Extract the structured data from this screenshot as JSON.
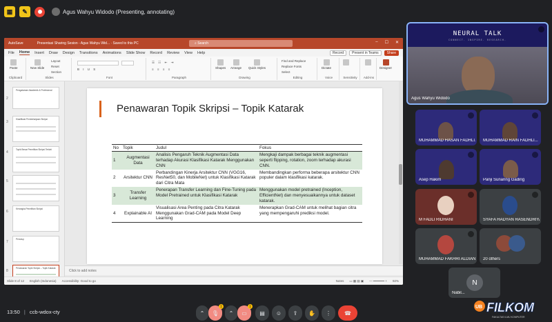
{
  "meet": {
    "presenter_label": "Agus Wahyu Widodo (Presenting, annotating)",
    "clock": "13:50",
    "meeting_code": "ccb-wdox-cty",
    "badge_count_1": "1",
    "badge_count_2": "1"
  },
  "ppt": {
    "autosave": "AutoSave",
    "doc_title": "Presentasi Sharing Sesion - Agus Wahyu Wid... · Saved to this PC",
    "search_placeholder": "Search",
    "menu": [
      "File",
      "Home",
      "Insert",
      "Draw",
      "Design",
      "Transitions",
      "Animations",
      "Slide Show",
      "Record",
      "Review",
      "View",
      "Help"
    ],
    "record_btn": "Record",
    "present_btn": "Present in Teams",
    "share_btn": "Share",
    "ribbon": {
      "paste": "Paste",
      "clipboard": "Clipboard",
      "new_slide": "New Slide",
      "layout": "Layout",
      "reset": "Reset",
      "section": "Section",
      "slides": "Slides",
      "font": "Font",
      "paragraph": "Paragraph",
      "shapes": "Shapes",
      "arrange": "Arrange",
      "quick_styles": "Quick Styles",
      "drawing": "Drawing",
      "find_replace": "Find and Replace",
      "replace_fonts": "Replace Fonts",
      "select": "Select",
      "editing": "Editing",
      "dictate": "Dictate",
      "voice": "Voice",
      "sensitivity": "Sensitivity",
      "addins": "Add-ins",
      "designer": "Designer"
    },
    "thumbs": [
      {
        "num": "2",
        "text": "Pengalaman Akademik & Profesional"
      },
      {
        "num": "3",
        "text": "Klasifikasi Pembelanjaan Skripsi"
      },
      {
        "num": "4",
        "text": "Topik Besar Penelitian Skripsi Terkini"
      },
      {
        "num": "5",
        "text": ""
      },
      {
        "num": "6",
        "text": "Kerangka Penelitian Skripsi"
      },
      {
        "num": "7",
        "text": "Penutup"
      },
      {
        "num": "8",
        "text": "Penawaran Topik Skripsi – Topik Katarak"
      },
      {
        "num": "9",
        "text": ""
      }
    ],
    "notes_placeholder": "Click to add notes",
    "status": {
      "slide_of": "Slide 8 of 12",
      "language": "English (Indonesia)",
      "accessibility": "Accessibility: Good to go",
      "notes": "Notes",
      "zoom": "92%"
    }
  },
  "slide": {
    "title": "Penawaran Topik Skripsi – Topik Katarak",
    "headers": [
      "No",
      "Topik",
      "Judul",
      "Fokus"
    ],
    "rows": [
      {
        "no": "1",
        "topik": "Augmentasi Data",
        "judul": "Analisis Pengaruh Teknik Augmentasi Data terhadap Akurasi Klasifikasi Katarak Menggunakan CNN",
        "fokus": "Mengkaji dampak berbagai teknik augmentasi seperti flipping, rotation, zoom terhadap akurasi CNN."
      },
      {
        "no": "2",
        "topik": "Arsitektur CNN",
        "judul": "Perbandingan Kinerja Arsitektur CNN (VGG16, ResNet50, dan MobileNet) untuk Klasifikasi Katarak dari Citra Mata",
        "fokus": "Membandingkan performa beberapa arsitektur CNN populer dalam klasifikasi katarak."
      },
      {
        "no": "3",
        "topik": "Transfer Learning",
        "judul": "Penerapan Transfer Learning dan Fine-Tuning pada Model Pretrained untuk Klasifikasi Katarak",
        "fokus": "Menggunakan model pretrained (Inception, EfficientNet) dan menyesuaikannya untuk dataset katarak."
      },
      {
        "no": "4",
        "topik": "Explainable AI",
        "judul": "Visualisasi Area Penting pada Citra Katarak Menggunakan Grad-CAM pada Model Deep Learning",
        "fokus": "Menerapkan Grad-CAM untuk melihat bagian citra yang mempengaruhi prediksi model."
      }
    ]
  },
  "participants": {
    "main": {
      "name": "Agus Wahyu Widodo",
      "banner": "NEURAL TALK",
      "tagline": "CONNECT. INSPIRE. RESEARCH."
    },
    "tiles": [
      {
        "name": "MUHAMMAD HASAN FADHLI..."
      },
      {
        "name": "MUHAMMAD RAIN FADHLI..."
      },
      {
        "name": "Asep Hakim"
      },
      {
        "name": "Panji Sunaring Gading"
      },
      {
        "name": "M FADLI RIDHANI"
      },
      {
        "name": "SYAFA HADYAN RASENDRIYA"
      },
      {
        "name": "MUHAMMAD FAKHRI ALDIAN..."
      },
      {
        "name": "20 others"
      },
      {
        "name": "N",
        "label": "Nabil..."
      }
    ]
  },
  "brand": {
    "logo_text": "FILKOM",
    "logo_sub": "FAKULTAS ILMU KOMPUTER",
    "ub": "UB"
  },
  "colors": {
    "ppt_accent": "#b7472a",
    "table_shade": "#d8e8d8",
    "meet_bg": "#202124",
    "end_call": "#ea4335",
    "title_bar": "#d9621b"
  }
}
